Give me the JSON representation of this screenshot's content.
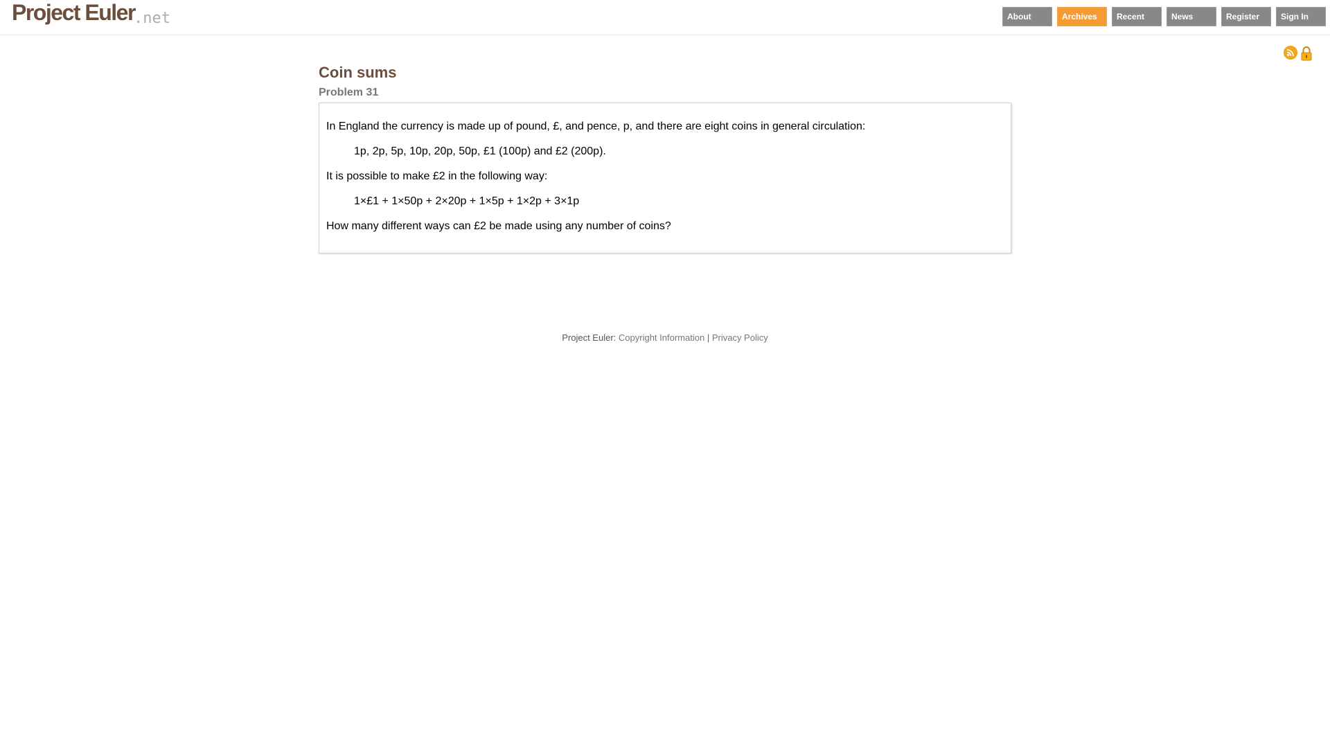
{
  "header": {
    "logo_main": "Project Euler",
    "logo_suffix": ".net",
    "nav": [
      {
        "label": "About",
        "active": false
      },
      {
        "label": "Archives",
        "active": true
      },
      {
        "label": "Recent",
        "active": false
      },
      {
        "label": "News",
        "active": false
      },
      {
        "label": "Register",
        "active": false
      },
      {
        "label": "Sign In",
        "active": false
      }
    ]
  },
  "icons": {
    "rss": "rss-feed-icon",
    "lock": "padlock-icon"
  },
  "problem": {
    "title": "Coin sums",
    "number_label": "Problem 31",
    "paragraphs": [
      "In England the currency is made up of pound, £, and pence, p, and there are eight coins in general circulation:",
      "1p, 2p, 5p, 10p, 20p, 50p, £1 (100p) and £2 (200p).",
      "It is possible to make £2 in the following way:",
      "1×£1 + 1×50p + 2×20p + 1×5p + 1×2p + 3×1p",
      "How many different ways can £2 be made using any number of coins?"
    ]
  },
  "footer": {
    "label": "Project Euler:",
    "copyright_link": "Copyright Information",
    "separator": "|",
    "privacy_link": "Privacy Policy"
  },
  "colors": {
    "brand_brown": "#6b4e3d",
    "nav_grey": "#888888",
    "nav_active": "#f59b33"
  }
}
